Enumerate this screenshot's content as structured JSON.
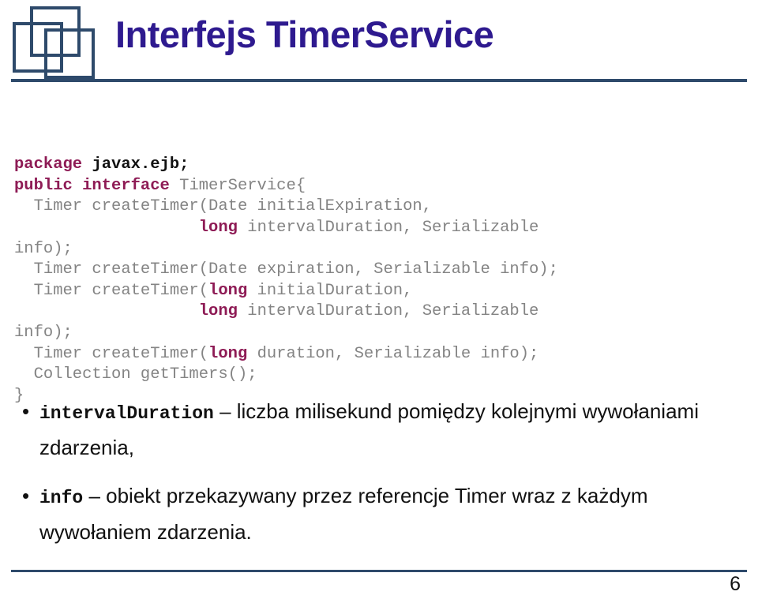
{
  "slide": {
    "title": "Interfejs TimerService",
    "page_number": "6",
    "accent_color": "#2e4a6b",
    "title_color": "#2e1a8f",
    "keyword_color": "#8e1b55",
    "code_color": "#848484"
  },
  "logo": {
    "name": "three-interlocking-squares-logo",
    "stroke_color": "#2e4a6b"
  },
  "code": {
    "language": "java",
    "lines": [
      [
        {
          "t": "package",
          "s": "kw"
        },
        {
          "t": " ",
          "s": "plain"
        },
        {
          "t": "javax.ejb;",
          "s": "pkg"
        }
      ],
      [
        {
          "t": "public interface",
          "s": "kw"
        },
        {
          "t": " TimerService{",
          "s": "plain"
        }
      ],
      [
        {
          "t": "  Timer createTimer(Date initialExpiration,",
          "s": "plain"
        }
      ],
      [
        {
          "t": "                   ",
          "s": "plain"
        },
        {
          "t": "long",
          "s": "kw"
        },
        {
          "t": " intervalDuration, Serializable",
          "s": "plain"
        }
      ],
      [
        {
          "t": "info);",
          "s": "plain"
        }
      ],
      [
        {
          "t": "  Timer createTimer(Date expiration, Serializable info);",
          "s": "plain"
        }
      ],
      [
        {
          "t": "  Timer createTimer(",
          "s": "plain"
        },
        {
          "t": "long",
          "s": "kw"
        },
        {
          "t": " initialDuration,",
          "s": "plain"
        }
      ],
      [
        {
          "t": "                   ",
          "s": "plain"
        },
        {
          "t": "long",
          "s": "kw"
        },
        {
          "t": " intervalDuration, Serializable",
          "s": "plain"
        }
      ],
      [
        {
          "t": "info);",
          "s": "plain"
        }
      ],
      [
        {
          "t": "  Timer createTimer(",
          "s": "plain"
        },
        {
          "t": "long",
          "s": "kw"
        },
        {
          "t": " duration, Serializable info);",
          "s": "plain"
        }
      ],
      [
        {
          "t": "  Collection getTimers();",
          "s": "plain"
        }
      ],
      [
        {
          "t": "}",
          "s": "plain"
        }
      ]
    ]
  },
  "bullets": [
    {
      "marker": "•",
      "term": "intervalDuration",
      "text": " – liczba milisekund pomiędzy kolejnymi wywołaniami zdarzenia,"
    },
    {
      "marker": "•",
      "term": "info",
      "text": " – obiekt przekazywany przez referencje Timer wraz z każdym wywołaniem zdarzenia."
    }
  ]
}
